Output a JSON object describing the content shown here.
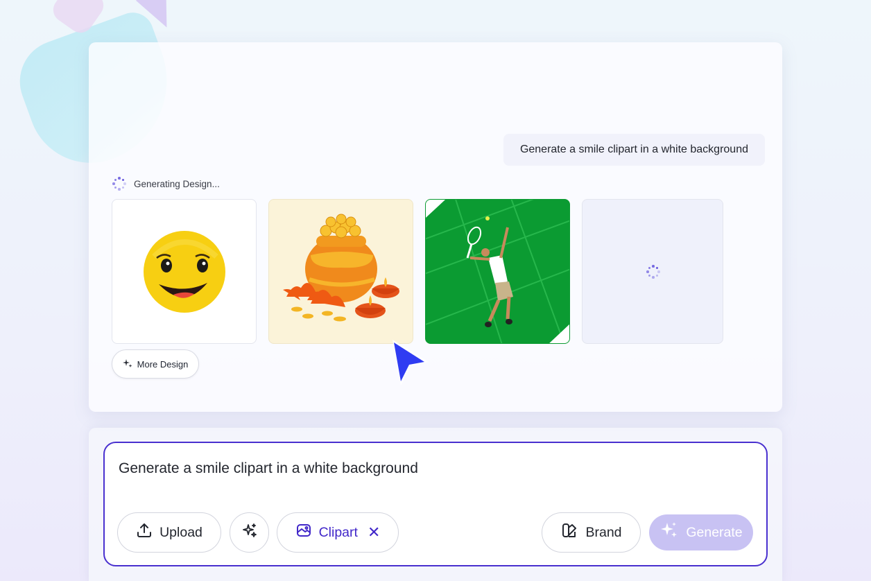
{
  "chat": {
    "user_prompt": "Generate a smile clipart in a white background",
    "status_text": "Generating Design...",
    "results": [
      {
        "name": "smile clipart"
      },
      {
        "name": "diwali gold pot clipart"
      },
      {
        "name": "tennis player clipart"
      },
      {
        "name": "loading placeholder"
      }
    ],
    "more_label": "More Design"
  },
  "composer": {
    "input_value": "Generate a smile clipart in a white background",
    "upload_label": "Upload",
    "chip_label": "Clipart",
    "brand_label": "Brand",
    "generate_label": "Generate"
  },
  "colors": {
    "accent": "#4930cf",
    "accent_text": "#4127c9",
    "generate_disabled": "#c8c2f3",
    "cursor": "#2f3cf2"
  }
}
